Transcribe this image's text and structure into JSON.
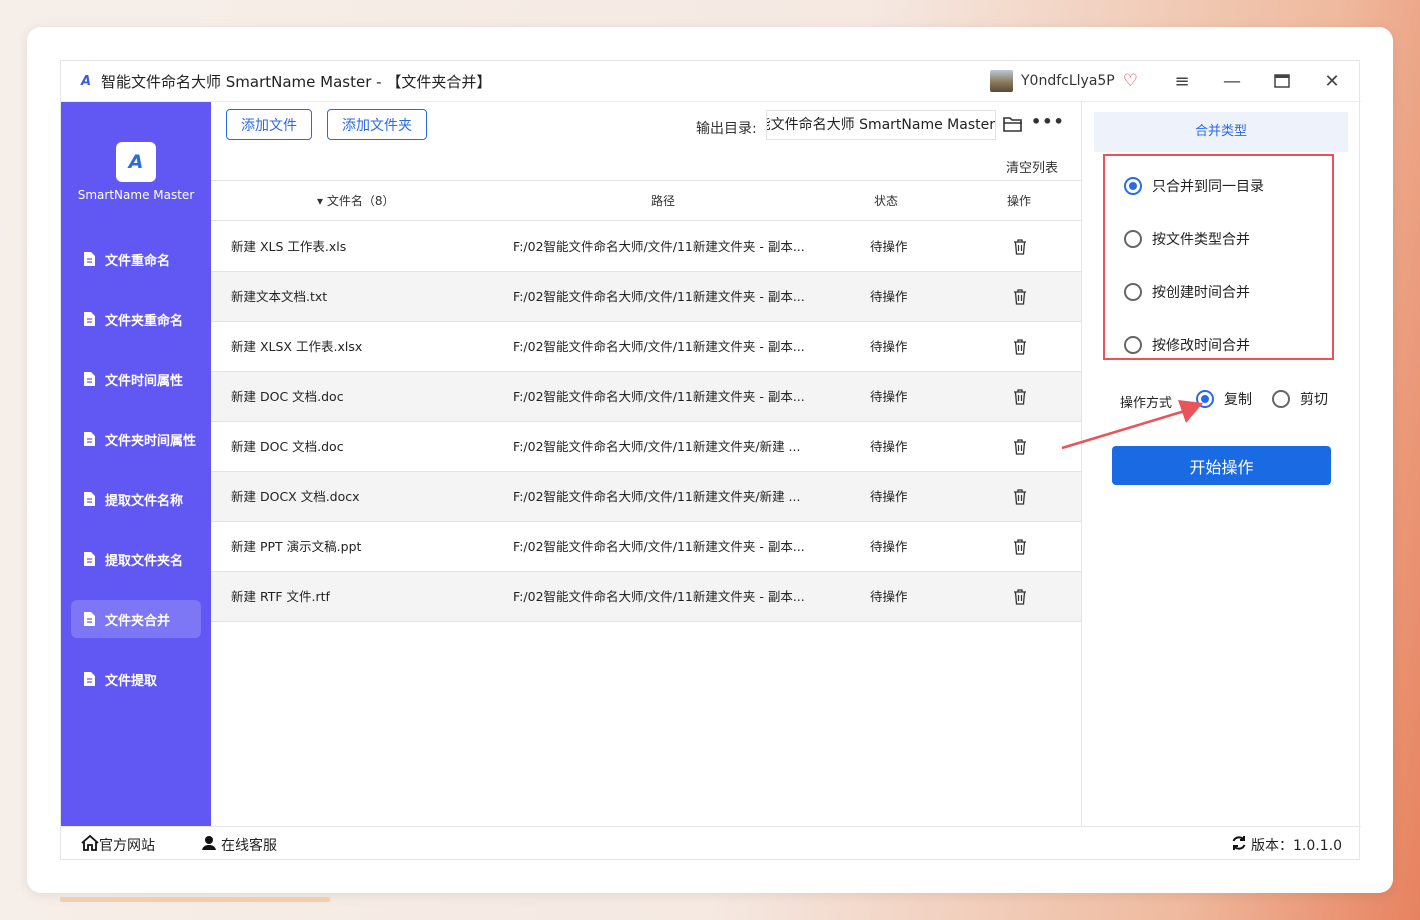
{
  "window": {
    "title": "智能文件命名大师 SmartName Master - 【文件夹合并】",
    "username": "Y0ndfcLlya5P"
  },
  "sidebar": {
    "logo_text": "SmartName Master",
    "items": [
      {
        "label": "文件重命名",
        "active": false
      },
      {
        "label": "文件夹重命名",
        "active": false
      },
      {
        "label": "文件时间属性",
        "active": false
      },
      {
        "label": "文件夹时间属性",
        "active": false
      },
      {
        "label": "提取文件名称",
        "active": false
      },
      {
        "label": "提取文件夹名",
        "active": false
      },
      {
        "label": "文件夹合并",
        "active": true
      },
      {
        "label": "文件提取",
        "active": false
      }
    ]
  },
  "toolbar": {
    "add_file": "添加文件",
    "add_folder": "添加文件夹",
    "output_label": "输出目录:",
    "output_value": "能文件命名大师 SmartName Master",
    "clear_list": "清空列表"
  },
  "table": {
    "headers": {
      "name": "文件名（8）",
      "path": "路径",
      "status": "状态",
      "action": "操作"
    },
    "rows": [
      {
        "name": "新建 XLS 工作表.xls",
        "path": "F:/02智能文件命名大师/文件/11新建文件夹 - 副本...",
        "status": "待操作"
      },
      {
        "name": "新建文本文档.txt",
        "path": "F:/02智能文件命名大师/文件/11新建文件夹 - 副本...",
        "status": "待操作"
      },
      {
        "name": "新建 XLSX 工作表.xlsx",
        "path": "F:/02智能文件命名大师/文件/11新建文件夹 - 副本...",
        "status": "待操作"
      },
      {
        "name": "新建 DOC 文档.doc",
        "path": "F:/02智能文件命名大师/文件/11新建文件夹 - 副本...",
        "status": "待操作"
      },
      {
        "name": "新建 DOC 文档.doc",
        "path": "F:/02智能文件命名大师/文件/11新建文件夹/新建 ...",
        "status": "待操作"
      },
      {
        "name": "新建 DOCX 文档.docx",
        "path": "F:/02智能文件命名大师/文件/11新建文件夹/新建 ...",
        "status": "待操作"
      },
      {
        "name": "新建 PPT 演示文稿.ppt",
        "path": "F:/02智能文件命名大师/文件/11新建文件夹 - 副本...",
        "status": "待操作"
      },
      {
        "name": "新建 RTF 文件.rtf",
        "path": "F:/02智能文件命名大师/文件/11新建文件夹 - 副本...",
        "status": "待操作"
      }
    ]
  },
  "right_panel": {
    "header": "合并类型",
    "merge_options": [
      {
        "label": "只合并到同一目录",
        "selected": true
      },
      {
        "label": "按文件类型合并",
        "selected": false
      },
      {
        "label": "按创建时间合并",
        "selected": false
      },
      {
        "label": "按修改时间合并",
        "selected": false
      }
    ],
    "op_label": "操作方式",
    "op_options": [
      {
        "label": "复制",
        "selected": true
      },
      {
        "label": "剪切",
        "selected": false
      }
    ],
    "start_button": "开始操作"
  },
  "bottom": {
    "website": "官方网站",
    "support": "在线客服",
    "version": "版本：1.0.1.0"
  },
  "colors": {
    "sidebar": "#6158f3",
    "accent": "#2b6ae6",
    "highlight": "#e8545a"
  }
}
